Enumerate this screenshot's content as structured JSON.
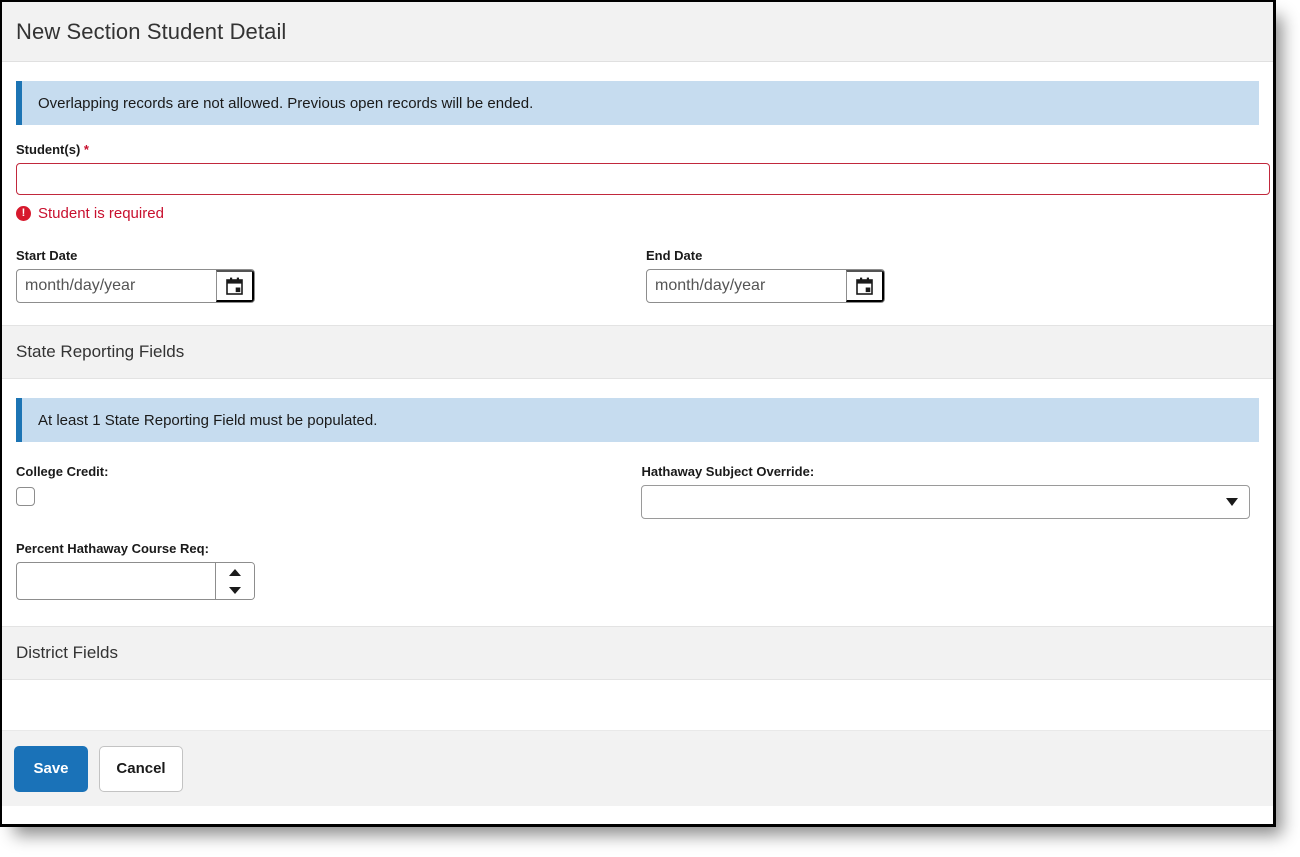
{
  "header": {
    "title": "New Section Student Detail"
  },
  "banners": {
    "overlap": "Overlapping records are not allowed. Previous open records will be ended.",
    "state_reporting": "At least 1 State Reporting Field must be populated."
  },
  "student": {
    "label": "Student(s)",
    "required_marker": "*",
    "value": "",
    "placeholder": "",
    "error_text": "Student is required",
    "error_icon": "error-exclamation-icon"
  },
  "dates": {
    "start": {
      "label": "Start Date",
      "value": "",
      "placeholder": "month/day/year",
      "calendar_icon": "calendar-icon"
    },
    "end": {
      "label": "End Date",
      "value": "",
      "placeholder": "month/day/year",
      "calendar_icon": "calendar-icon"
    }
  },
  "sections": {
    "state_reporting_title": "State Reporting Fields",
    "district_title": "District Fields"
  },
  "state_fields": {
    "college_credit": {
      "label": "College Credit:",
      "checked": false
    },
    "hathaway_subject_override": {
      "label": "Hathaway Subject Override:",
      "value": "",
      "arrow_icon": "chevron-down-icon"
    },
    "percent_hathaway": {
      "label": "Percent Hathaway Course Req:",
      "value": "",
      "placeholder": "",
      "up_icon": "triangle-up-icon",
      "down_icon": "triangle-down-icon"
    }
  },
  "footer": {
    "save_label": "Save",
    "cancel_label": "Cancel"
  },
  "colors": {
    "accent_blue": "#1a72b8",
    "banner_bg": "#c6dcef",
    "banner_bar": "#1c74b4",
    "error_red": "#c8102e",
    "band_gray": "#f2f2f2"
  }
}
